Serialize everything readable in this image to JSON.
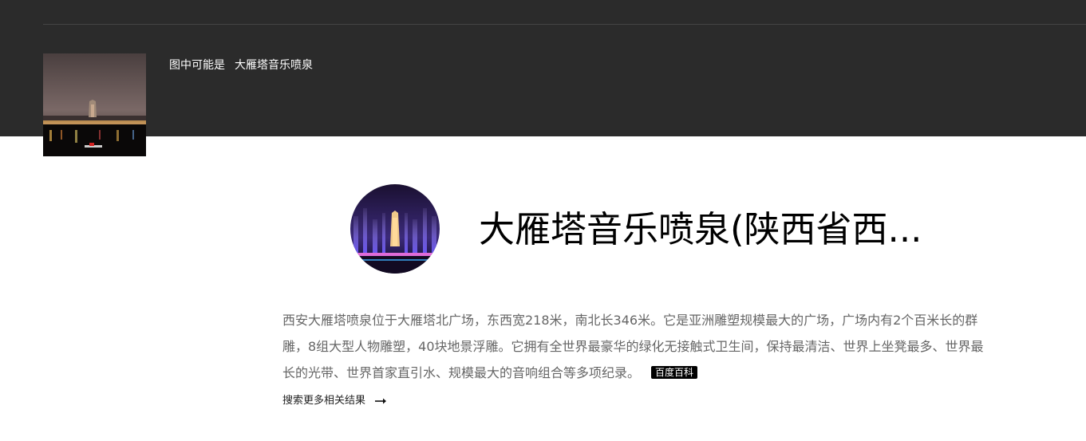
{
  "query": {
    "caption_prefix": "图中可能是",
    "recognized_name": "大雁塔音乐喷泉"
  },
  "result": {
    "title": "大雁塔音乐喷泉(陕西省西...",
    "description": "西安大雁塔喷泉位于大雁塔北广场，东西宽218米，南北长346米。它是亚洲雕塑规模最大的广场，广场内有2个百米长的群雕，8组大型人物雕塑，40块地景浮雕。它拥有全世界最豪华的绿化无接触式卫生间，保持最清洁、世界上坐凳最多、世界最长的光带、世界首家直引水、规模最大的音响组合等多项纪录。",
    "source_label": "百度百科",
    "more_label": "搜索更多相关结果",
    "more_icon": "arrow-right-icon"
  },
  "colors": {
    "top_band": "#2b2b2b",
    "description_text": "#666666",
    "badge_bg": "#000000"
  }
}
